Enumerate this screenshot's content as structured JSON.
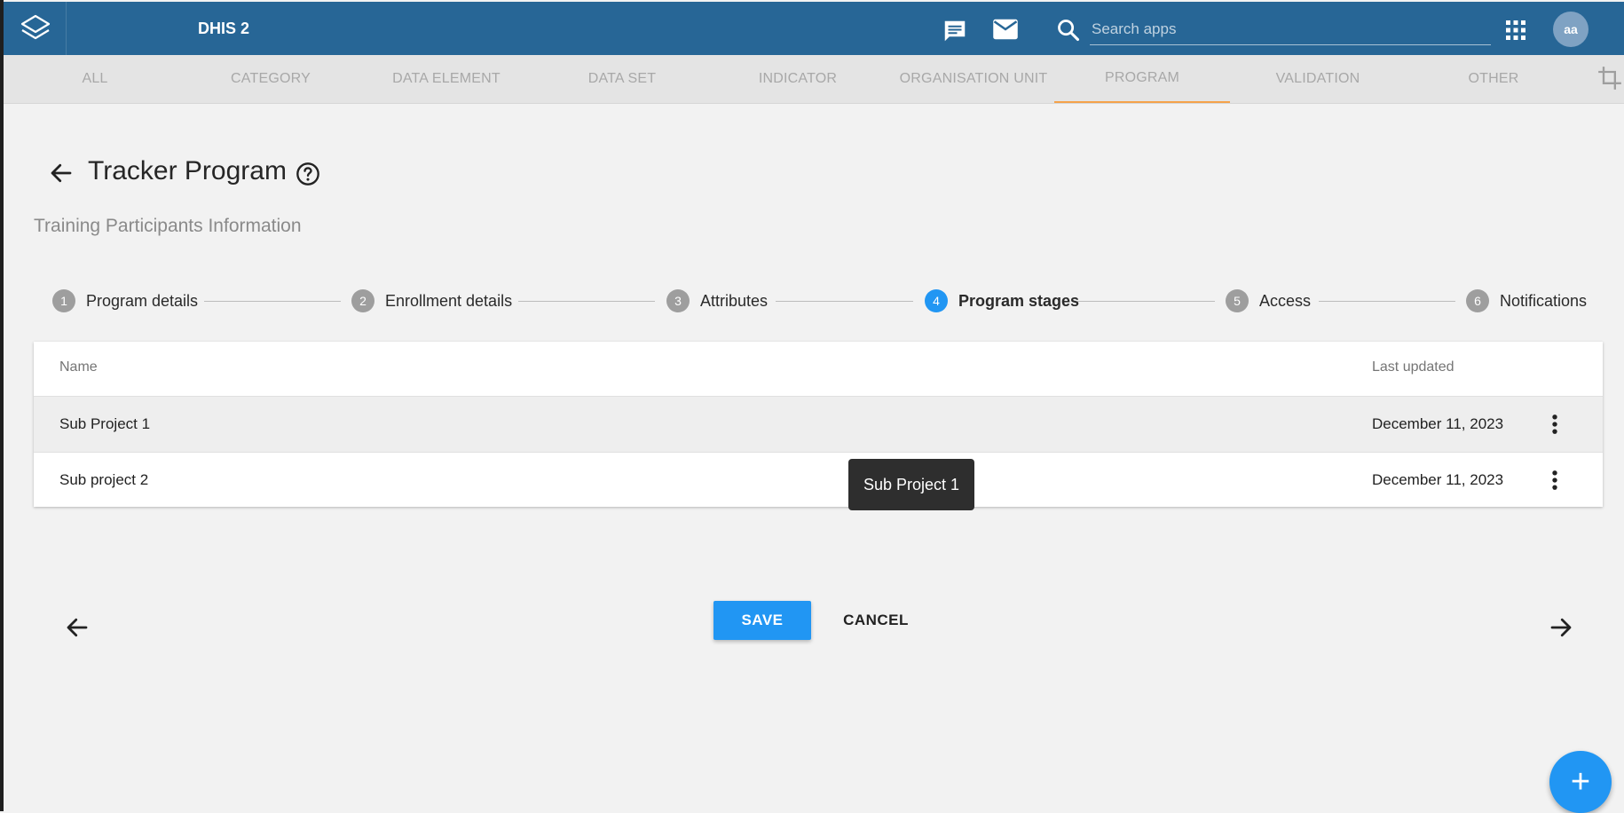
{
  "header": {
    "app_title": "DHIS 2",
    "search_placeholder": "Search apps",
    "user_initials": "aa",
    "bg_color": "#276696"
  },
  "tabs": [
    {
      "label": "ALL",
      "active": false
    },
    {
      "label": "CATEGORY",
      "active": false
    },
    {
      "label": "DATA ELEMENT",
      "active": false
    },
    {
      "label": "DATA SET",
      "active": false
    },
    {
      "label": "INDICATOR",
      "active": false
    },
    {
      "label": "ORGANISATION UNIT",
      "active": false
    },
    {
      "label": "PROGRAM",
      "active": true
    },
    {
      "label": "VALIDATION",
      "active": false
    },
    {
      "label": "OTHER",
      "active": false
    }
  ],
  "page": {
    "title": "Tracker Program",
    "subtitle": "Training Participants Information"
  },
  "stepper": [
    {
      "num": "1",
      "label": "Program details",
      "active": false
    },
    {
      "num": "2",
      "label": "Enrollment details",
      "active": false
    },
    {
      "num": "3",
      "label": "Attributes",
      "active": false
    },
    {
      "num": "4",
      "label": "Program stages",
      "active": true
    },
    {
      "num": "5",
      "label": "Access",
      "active": false
    },
    {
      "num": "6",
      "label": "Notifications",
      "active": false
    }
  ],
  "table": {
    "columns": [
      "Name",
      "Last updated"
    ],
    "rows": [
      {
        "name": "Sub Project 1",
        "last_updated": "December 11, 2023"
      },
      {
        "name": "Sub project 2",
        "last_updated": "December 11, 2023"
      }
    ]
  },
  "tooltip": "Sub Project 1",
  "actions": {
    "save_label": "SAVE",
    "cancel_label": "CANCEL",
    "fab_label": "+"
  },
  "colors": {
    "accent": "#2196f3",
    "active_tab_underline": "#f5a24a"
  }
}
